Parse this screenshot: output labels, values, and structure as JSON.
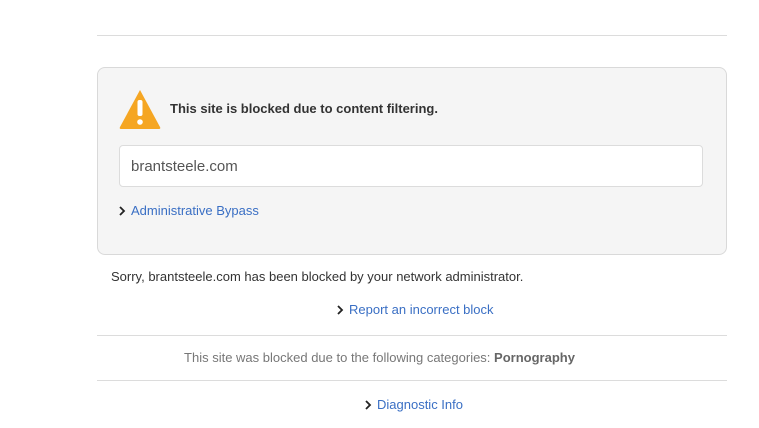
{
  "block": {
    "headline": "This site is blocked due to content filtering.",
    "url": "brantsteele.com",
    "bypass_label": "Administrative Bypass"
  },
  "message": {
    "sorry_text": "Sorry, brantsteele.com has been blocked by your network administrator.",
    "report_label": "Report an incorrect block"
  },
  "categories": {
    "prefix": "This site was blocked due to the following categories:",
    "list": "Pornography"
  },
  "diagnostic": {
    "label": "Diagnostic Info"
  },
  "icons": {
    "warning": "warning-triangle-icon",
    "chevron": "chevron-right-icon"
  },
  "colors": {
    "warning": "#f5a623",
    "link": "#3a6fc4",
    "card_bg": "#f5f5f5"
  }
}
